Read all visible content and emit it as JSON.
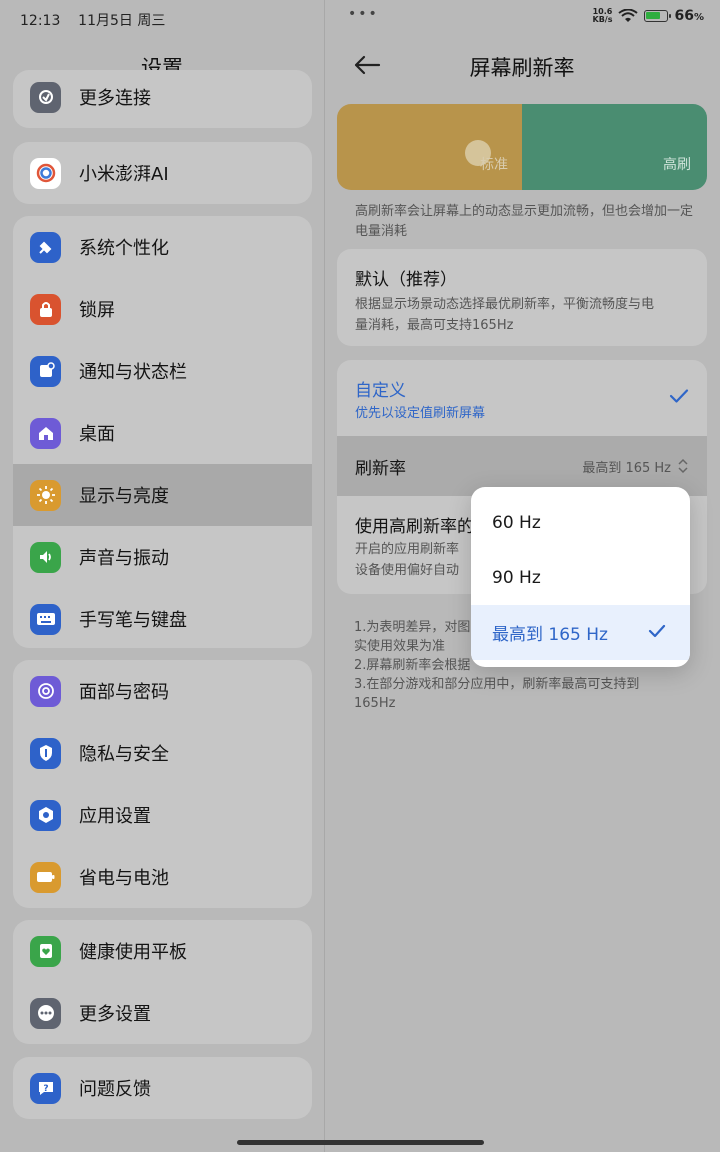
{
  "status_bar": {
    "time": "12:13",
    "date": "11月5日 周三",
    "dots": "•••",
    "net_speed_value": "10.6",
    "net_speed_unit": "KB/s",
    "battery": "66",
    "battery_unit": "%"
  },
  "left": {
    "title": "设置",
    "cards": [
      [
        {
          "label": "更多连接",
          "icon": "link-icon",
          "color": "#5f6470"
        }
      ],
      [
        {
          "label": "小米澎湃AI",
          "icon": "ai-swirl-icon",
          "color": "#ffffff"
        }
      ],
      [
        {
          "label": "系统个性化",
          "icon": "brush-icon",
          "color": "#2e62c9"
        },
        {
          "label": "锁屏",
          "icon": "lock-icon",
          "color": "#d9532f"
        },
        {
          "label": "通知与状态栏",
          "icon": "notification-icon",
          "color": "#2e62c9"
        },
        {
          "label": "桌面",
          "icon": "home-icon",
          "color": "#6e5bd6"
        },
        {
          "label": "显示与亮度",
          "icon": "sun-icon",
          "color": "#d99a2f"
        },
        {
          "label": "声音与振动",
          "icon": "speaker-icon",
          "color": "#3aa54a"
        },
        {
          "label": "手写笔与键盘",
          "icon": "keyboard-icon",
          "color": "#2e62c9"
        }
      ],
      [
        {
          "label": "面部与密码",
          "icon": "face-icon",
          "color": "#6e5bd6"
        },
        {
          "label": "隐私与安全",
          "icon": "shield-icon",
          "color": "#2e62c9"
        },
        {
          "label": "应用设置",
          "icon": "app-gear-icon",
          "color": "#2e62c9"
        },
        {
          "label": "省电与电池",
          "icon": "battery-icon",
          "color": "#d99a2f"
        }
      ],
      [
        {
          "label": "健康使用平板",
          "icon": "health-icon",
          "color": "#3aa54a"
        },
        {
          "label": "更多设置",
          "icon": "more-icon",
          "color": "#5f6470"
        }
      ],
      [
        {
          "label": "问题反馈",
          "icon": "feedback-icon",
          "color": "#2e62c9"
        }
      ]
    ],
    "selected": "显示与亮度"
  },
  "right": {
    "title": "屏幕刷新率",
    "preview": {
      "standard_label": "标准",
      "high_label": "高刷"
    },
    "description": "高刷新率会让屏幕上的动态显示更加流畅，但也会增加一定电量消耗",
    "default_option": {
      "title": "默认（推荐）",
      "subtitle": "根据显示场景动态选择最优刷新率，平衡流畅度与电量消耗，最高可支持165Hz"
    },
    "custom_option": {
      "title": "自定义",
      "subtitle": "优先以设定值刷新屏幕",
      "refresh_label": "刷新率",
      "refresh_value": "最高到 165 Hz",
      "high_apps_title": "使用高刷新率的",
      "high_apps_sub1": "开启的应用刷新率",
      "high_apps_sub2": "设备使用偏好自动"
    },
    "notes": {
      "line1": "1.为表明差异，对图",
      "line2": "实使用效果为准",
      "line3": "2.屏幕刷新率会根据",
      "line4": "3.在部分游戏和部分应用中，刷新率最高可支持到",
      "line5": "165Hz"
    }
  },
  "dropdown": {
    "options": [
      "60 Hz",
      "90 Hz",
      "最高到 165 Hz"
    ],
    "selected_index": 2
  },
  "colors": {
    "accent": "#2f66c8",
    "preview_standard": "#b8944b",
    "preview_high": "#4a8d71"
  }
}
